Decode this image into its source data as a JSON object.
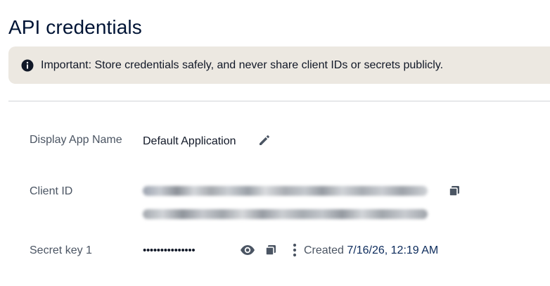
{
  "page": {
    "title": "API credentials"
  },
  "notice": {
    "icon": "info-icon",
    "text": "Important: Store credentials safely, and never share client IDs or secrets publicly."
  },
  "credentials": {
    "display_app_name": {
      "label": "Display App Name",
      "value": "Default Application",
      "edit_icon": "pencil-icon"
    },
    "client_id": {
      "label": "Client ID",
      "copy_icon": "copy-icon"
    },
    "secret_key": {
      "label": "Secret key 1",
      "masked_value": "•••••••••••••••",
      "reveal_icon": "eye-icon",
      "copy_icon": "copy-icon",
      "menu_icon": "more-vertical-icon",
      "created_label": "Created",
      "created_value": "7/16/26, 12:19 AM"
    }
  },
  "colors": {
    "title": "#001435",
    "notice_bg": "#ece8e1",
    "divider": "#d2d4d7",
    "label": "#4b5563",
    "text": "#111827",
    "icon": "#4b5563",
    "created_value": "#0b2a5b"
  }
}
